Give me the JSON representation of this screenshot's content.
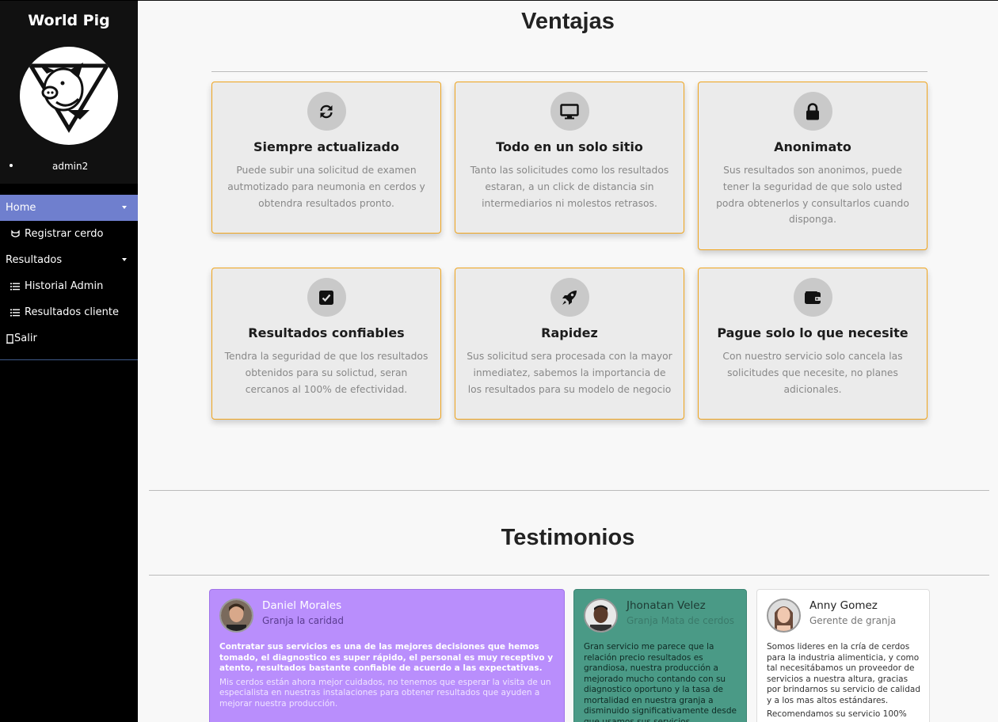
{
  "sidebar": {
    "brand": "World Pig",
    "user": "admin2",
    "items": [
      {
        "label": "Home",
        "icon": "chevron-down-icon"
      },
      {
        "label": "Registrar cerdo",
        "icon": "pig-head-icon"
      },
      {
        "label": "Resultados",
        "icon": "chevron-down-icon"
      },
      {
        "label": "Historial Admin",
        "icon": "list-icon"
      },
      {
        "label": "Resultados cliente",
        "icon": "list-icon"
      },
      {
        "label": "Salir",
        "icon": "door-icon"
      }
    ]
  },
  "ventajas": {
    "title": "Ventajas",
    "cards": [
      {
        "icon": "refresh-icon",
        "title": "Siempre actualizado",
        "text": "Puede subir una solicitud de examen autmotizado para neumonia en cerdos y obtendra resultados pronto."
      },
      {
        "icon": "monitor-icon",
        "title": "Todo en un solo sitio",
        "text": "Tanto las solicitudes como los resultados estaran, a un click de distancia sin intermediarios ni molestos retrasos."
      },
      {
        "icon": "lock-icon",
        "title": "Anonimato",
        "text": "Sus resultados son anonimos, puede tener la seguridad de que solo usted podra obtenerlos y consultarlos cuando disponga."
      },
      {
        "icon": "check-square-icon",
        "title": "Resultados confiables",
        "text": "Tendra la seguridad de que los resultados obtenidos para su solictud, seran cercanos al 100% de efectividad."
      },
      {
        "icon": "rocket-icon",
        "title": "Rapidez",
        "text": "Sus solicitud sera procesada con la mayor inmediatez, sabemos la importancia de los resultados para su modelo de negocio"
      },
      {
        "icon": "wallet-icon",
        "title": "Pague solo lo que necesite",
        "text": "Con nuestro servicio solo cancela las solicitudes que necesite, no planes adicionales."
      }
    ]
  },
  "testimonios": {
    "title": "Testimonios",
    "items": [
      {
        "name": "Daniel Morales",
        "role": "Granja la caridad",
        "text": "Contratar sus servicios es una de las mejores decisiones que hemos tomado, el diagnostico es super rápido, el personal es muy receptivo y atento, resultados bastante confiable de acuerdo a las expectativas.",
        "text2": "Mis cerdos están ahora mejor cuidados, no tenemos que esperar la visita de un especialista en nuestras instalaciones para obtener resultados que ayuden a mejorar nuestra producción."
      },
      {
        "name": "Jhonatan Velez",
        "role": "Granja Mata de cerdos",
        "text": "Gran servicio me parece que la relación precio resultados es grandiosa, nuestra producción a mejorado mucho contando con su diagnostico oportuno y la tasa de mortalidad en nuestra granja a disminuido significativamente desde que usamos sus servicios."
      },
      {
        "name": "Anny Gomez",
        "role": "Gerente de granja",
        "text": "Somos lideres en la cría de cerdos para la industria alimenticia, y como tal necesitábamos un proveedor de servicios a nuestra altura, gracias por brindarnos su servicio de calidad y a los mas altos estándares.",
        "text2": "Recomendamos su servicio 100%"
      }
    ]
  },
  "colors": {
    "accent": "#6f7fce",
    "card_border": "#f0a51e",
    "purple_card": "#b98efc",
    "green_card": "#4a9a86"
  }
}
